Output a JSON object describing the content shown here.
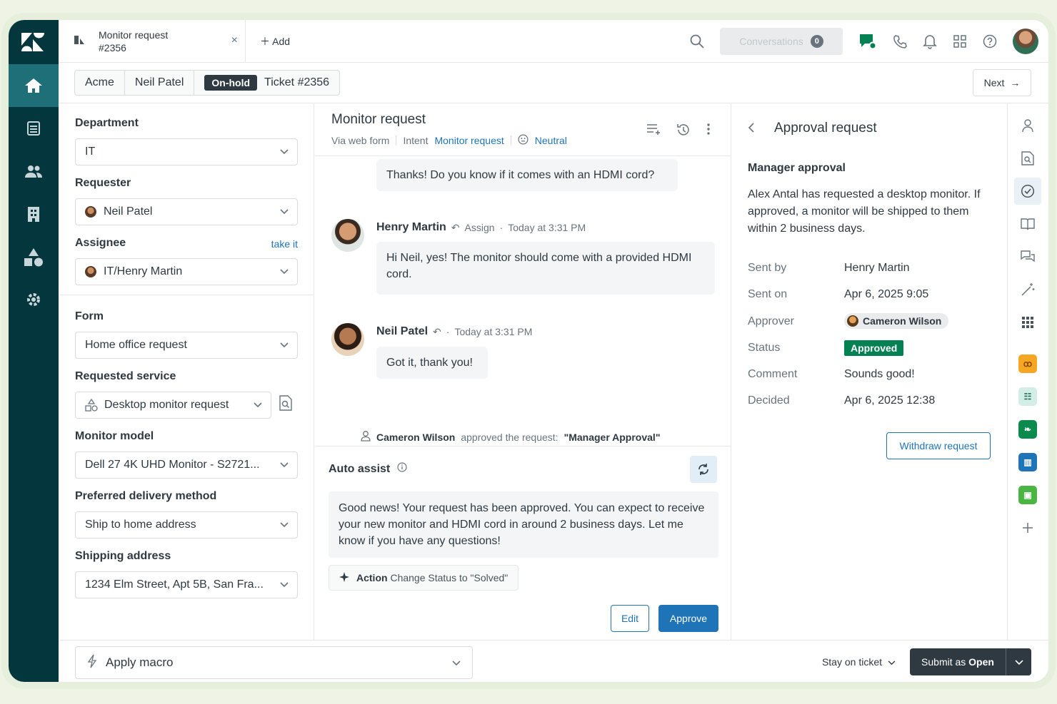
{
  "tab": {
    "title_line1": "Monitor request",
    "title_line2": "#2356",
    "close": "×"
  },
  "add_label": "Add",
  "topbar": {
    "conversations_label": "Conversations",
    "conversations_count": "0"
  },
  "breadcrumbs": {
    "org": "Acme",
    "requester": "Neil Patel",
    "status": "On-hold",
    "ticket": "Ticket #2356"
  },
  "next_label": "Next",
  "fields": {
    "department": {
      "label": "Department",
      "value": "IT"
    },
    "requester": {
      "label": "Requester",
      "value": "Neil Patel"
    },
    "assignee": {
      "label": "Assignee",
      "value": "IT/Henry Martin",
      "take_it": "take it"
    },
    "form": {
      "label": "Form",
      "value": "Home office request"
    },
    "requested_service": {
      "label": "Requested service",
      "value": "Desktop monitor request"
    },
    "monitor_model": {
      "label": "Monitor model",
      "value": "Dell 27 4K UHD Monitor - S2721..."
    },
    "delivery": {
      "label": "Preferred delivery method",
      "value": "Ship to home address"
    },
    "shipping": {
      "label": "Shipping address",
      "value": "1234 Elm Street, Apt 5B, San Fra..."
    }
  },
  "conversation": {
    "title": "Monitor request",
    "via": "Via web form",
    "intent_label": "Intent",
    "intent_value": "Monitor request",
    "sentiment": "Neutral",
    "messages": [
      {
        "text": "Thanks! Do you know if it comes with an HDMI cord?"
      },
      {
        "author": "Henry Martin",
        "assign": "Assign",
        "time": "Today at 3:31 PM",
        "text": "Hi Neil, yes! The monitor should come with a provided HDMI cord."
      },
      {
        "author": "Neil Patel",
        "time": "Today at 3:31 PM",
        "text": "Got it, thank you!"
      }
    ],
    "system": {
      "who": "Cameron Wilson",
      "middle": "approved the request:",
      "what": "\"Manager Approval\""
    }
  },
  "auto_assist": {
    "label": "Auto assist",
    "text": "Good news! Your request has been approved. You can expect to receive your new monitor and HDMI cord in around 2 business days. Let me know if you have any questions!",
    "action_bold": "Action",
    "action_text": "Change Status to \"Solved\"",
    "edit": "Edit",
    "approve": "Approve"
  },
  "approval": {
    "title": "Approval request",
    "subtitle": "Manager approval",
    "description": "Alex Antal has requested a desktop monitor. If approved, a monitor will be shipped to them within 2 business days.",
    "rows": [
      {
        "k": "Sent by",
        "v": "Henry Martin"
      },
      {
        "k": "Sent on",
        "v": "Apr 6, 2025 9:05"
      },
      {
        "k": "Approver",
        "v": "Cameron Wilson"
      },
      {
        "k": "Status",
        "v": "Approved"
      },
      {
        "k": "Comment",
        "v": "Sounds good!"
      },
      {
        "k": "Decided",
        "v": "Apr 6, 2025 12:38"
      }
    ],
    "withdraw": "Withdraw request"
  },
  "bottom": {
    "macro": "Apply macro",
    "stay": "Stay on ticket",
    "submit_prefix": "Submit as",
    "submit_status": "Open"
  },
  "colors": {
    "nav": "#03363d",
    "accent": "#1f73b7",
    "approved": "#038153"
  }
}
